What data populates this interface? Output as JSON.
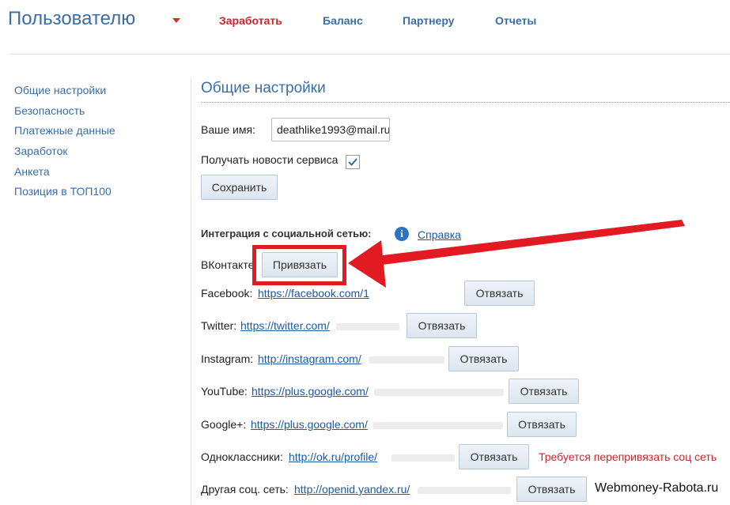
{
  "header": {
    "title": "Пользователю",
    "nav": [
      {
        "label": "Заработать",
        "active": true
      },
      {
        "label": "Баланс"
      },
      {
        "label": "Партнеру"
      },
      {
        "label": "Отчеты"
      }
    ]
  },
  "sidebar": {
    "items": [
      {
        "label": "Общие настройки"
      },
      {
        "label": "Безопасность"
      },
      {
        "label": "Платежные данные"
      },
      {
        "label": "Заработок"
      },
      {
        "label": "Анкета"
      },
      {
        "label": "Позиция в ТОП100"
      }
    ]
  },
  "main": {
    "title": "Общие настройки",
    "name_label": "Ваше имя:",
    "name_value": "deathlike1993@mail.ru",
    "news_label": "Получать новости сервиса",
    "news_checked": true,
    "save_button": "Сохранить",
    "social_heading": "Интеграция с социальной сетью:",
    "help_link": "Справка",
    "social": [
      {
        "network": "ВКонтакте",
        "link": "",
        "button": "Привязать"
      },
      {
        "network": "Facebook:",
        "link": "https://facebook.com/1",
        "button": "Отвязать"
      },
      {
        "network": "Twitter:",
        "link": "https://twitter.com/",
        "button": "Отвязать"
      },
      {
        "network": "Instagram:",
        "link": "http://instagram.com/",
        "button": "Отвязать"
      },
      {
        "network": "YouTube:",
        "link": "https://plus.google.com/",
        "button": "Отвязать"
      },
      {
        "network": "Google+:",
        "link": "https://plus.google.com/",
        "button": "Отвязать"
      },
      {
        "network": "Одноклассники:",
        "link": "http://ok.ru/profile/",
        "button": "Отвязать",
        "note": "Требуется перепривязать соц сеть"
      },
      {
        "network": "Другая соц. сеть:",
        "link": "http://openid.yandex.ru/",
        "button": "Отвязать"
      }
    ]
  },
  "watermark": "Webmoney-Rabota.ru",
  "colors": {
    "accent": "#3a6ea5",
    "active_nav": "#c8262d",
    "highlight": "#e21b22",
    "link": "#1a5aa6"
  }
}
